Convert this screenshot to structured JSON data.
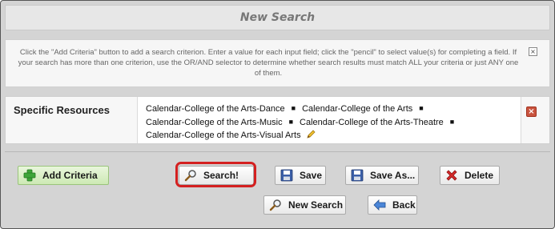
{
  "header": {
    "title": "New Search"
  },
  "instructions": {
    "text": "Click the \"Add Criteria\" button to add a search criterion. Enter a value for each input field; click the \"pencil\" to select value(s) for completing a field. If your search has more than one criterion, use the OR/AND selector to determine whether search results must match ALL your criteria or just ANY one of them.",
    "close_label": "×"
  },
  "criteria": {
    "label": "Specific Resources",
    "values": [
      "Calendar-College of the Arts-Dance",
      "Calendar-College of the Arts",
      "Calendar-College of the Arts-Music",
      "Calendar-College of the Arts-Theatre",
      "Calendar-College of the Arts-Visual Arts"
    ],
    "separator": "■",
    "remove_label": "×"
  },
  "buttons": {
    "add_criteria": "Add Criteria",
    "search": "Search!",
    "save": "Save",
    "save_as": "Save As...",
    "delete": "Delete",
    "new_search": "New Search",
    "back": "Back"
  },
  "icons": {
    "add_criteria": "green-plus-icon",
    "search": "magnifier-icon",
    "save": "floppy-disk-icon",
    "save_as": "floppy-disk-icon",
    "delete": "red-x-icon",
    "new_search": "magnifier-icon",
    "back": "back-arrow-icon",
    "edit": "pencil-icon"
  },
  "colors": {
    "highlight": "#d42020",
    "add_button_bg": "#cde9b4",
    "remove_button": "#c9543f"
  }
}
